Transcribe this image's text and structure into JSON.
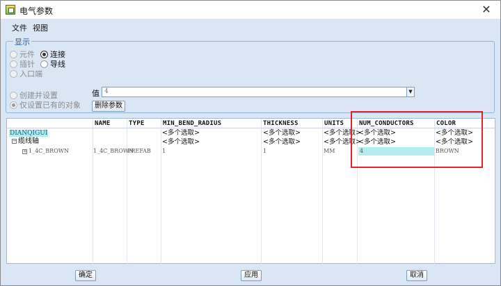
{
  "window": {
    "title": "电气参数",
    "close_glyph": "✕"
  },
  "menu": {
    "items": [
      "文件",
      "视图"
    ]
  },
  "display_group": {
    "legend": "显示",
    "options": {
      "component": "元件",
      "pin": "插针",
      "entry_port": "入口端",
      "connection": "连接",
      "wire": "导线"
    }
  },
  "mode": {
    "create_and_set": "创建并设置",
    "only_existing": "仅设置已有的对象"
  },
  "value": {
    "label": "值",
    "current": "4"
  },
  "buttons": {
    "delete_param": "删除参数",
    "ok": "确定",
    "apply": "应用",
    "cancel": "取消"
  },
  "table": {
    "headers": [
      "NAME",
      "TYPE",
      "MIN_BEND_RADIUS",
      "THICKNESS",
      "UNITS",
      "NUM_CONDUCTORS",
      "COLOR"
    ],
    "multi": "<多个选取>",
    "tree": {
      "root": "DIANQIGUI",
      "bundle": "缆线轴",
      "cable": "1_4C_BROWN"
    },
    "cable_row": {
      "name": "1_4C_BROWN",
      "type": "PREFAB",
      "min_bend_radius": "1",
      "thickness": "1",
      "units": "MM",
      "num_conductors": "4",
      "color": "BROWN"
    }
  },
  "colors": {
    "highlight": "#b4ebec",
    "annotation": "#e8202a",
    "window_bg": "#dbe6f5"
  }
}
